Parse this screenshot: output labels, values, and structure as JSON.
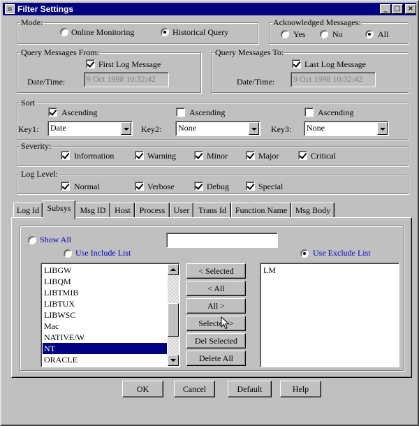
{
  "window": {
    "title": "Filter Settings"
  },
  "mode": {
    "label": "Mode:",
    "options": [
      "Online Monitoring",
      "Historical Query"
    ],
    "selected": "Historical Query"
  },
  "ack": {
    "label": "Acknowledged Messages:",
    "options": [
      "Yes",
      "No",
      "All"
    ],
    "selected": "All"
  },
  "from": {
    "label": "Query Messages From:",
    "check_label": "First Log Message",
    "checked": true,
    "date_label": "Date/Time:",
    "date_value": "9 Oct 1998 10:32:42"
  },
  "to": {
    "label": "Query Messages To:",
    "check_label": "Last Log Message",
    "checked": true,
    "date_label": "Date/Time:",
    "date_value": "9 Oct 1998 10:32:42"
  },
  "sort": {
    "label": "Sort",
    "keys": [
      {
        "label": "Key1:",
        "ascending_label": "Ascending",
        "ascending": true,
        "value": "Date"
      },
      {
        "label": "Key2:",
        "ascending_label": "Ascending",
        "ascending": false,
        "value": "None"
      },
      {
        "label": "Key3:",
        "ascending_label": "Ascending",
        "ascending": false,
        "value": "None"
      }
    ]
  },
  "severity": {
    "label": "Severity:",
    "items": [
      {
        "label": "Information",
        "checked": true
      },
      {
        "label": "Warning",
        "checked": true
      },
      {
        "label": "Minor",
        "checked": true
      },
      {
        "label": "Major",
        "checked": true
      },
      {
        "label": "Critical",
        "checked": true
      }
    ]
  },
  "loglevel": {
    "label": "Log Level:",
    "items": [
      {
        "label": "Normal",
        "checked": true
      },
      {
        "label": "Verbose",
        "checked": true
      },
      {
        "label": "Debug",
        "checked": true
      },
      {
        "label": "Special",
        "checked": true
      }
    ]
  },
  "tabs": [
    "Log Id",
    "Subsys",
    "Msg ID",
    "Host",
    "Process",
    "User",
    "Trans Id",
    "Function Name",
    "Msg Body"
  ],
  "active_tab": "Subsys",
  "subsys": {
    "show_all_label": "Show All",
    "show_all_text": "",
    "include_label": "Use Include List",
    "exclude_label": "Use Exclude List",
    "selected_mode": "Use Exclude List",
    "available": [
      "LIBGW",
      "LIBQM",
      "LIBTMIB",
      "LIBTUX",
      "LIBWSC",
      "Mac",
      "NATIVE/W",
      "NT",
      "ORACLE"
    ],
    "available_selected": "NT",
    "excluded": [
      "LM"
    ],
    "buttons": [
      "< Selected",
      "< All",
      "All >",
      "Selected >",
      "Del Selected",
      "Delete All"
    ]
  },
  "footer": {
    "ok": "OK",
    "cancel": "Cancel",
    "default": "Default",
    "help": "Help"
  }
}
